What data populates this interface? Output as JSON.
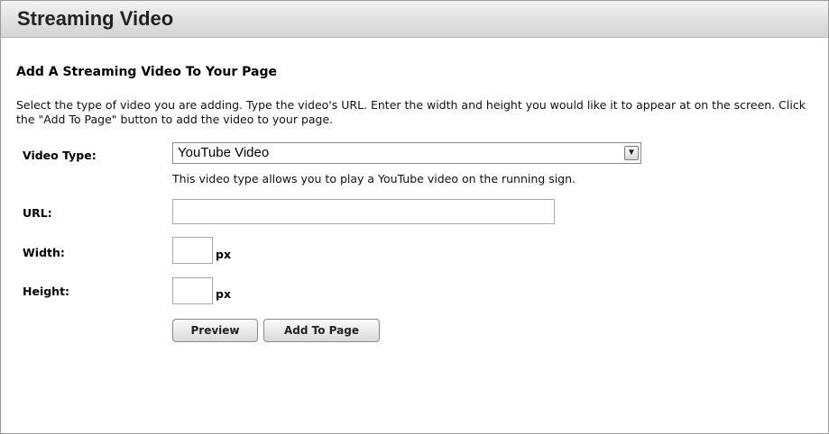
{
  "header": {
    "title": "Streaming Video"
  },
  "form": {
    "subtitle": "Add A Streaming Video To Your Page",
    "instructions": "Select the type of video you are adding. Type the video's URL. Enter the width and height you would like it to appear at on the screen. Click the \"Add To Page\" button to add the video to your page.",
    "video_type": {
      "label": "Video Type:",
      "selected": "YouTube Video",
      "arrow_icon": "chevron-down-icon",
      "hint": "This video type allows you to play a YouTube video on the running sign."
    },
    "url": {
      "label": "URL:",
      "value": ""
    },
    "width": {
      "label": "Width:",
      "value": "",
      "unit": "px"
    },
    "height": {
      "label": "Height:",
      "value": "",
      "unit": "px"
    },
    "buttons": {
      "preview": "Preview",
      "add_to_page": "Add To Page"
    }
  }
}
